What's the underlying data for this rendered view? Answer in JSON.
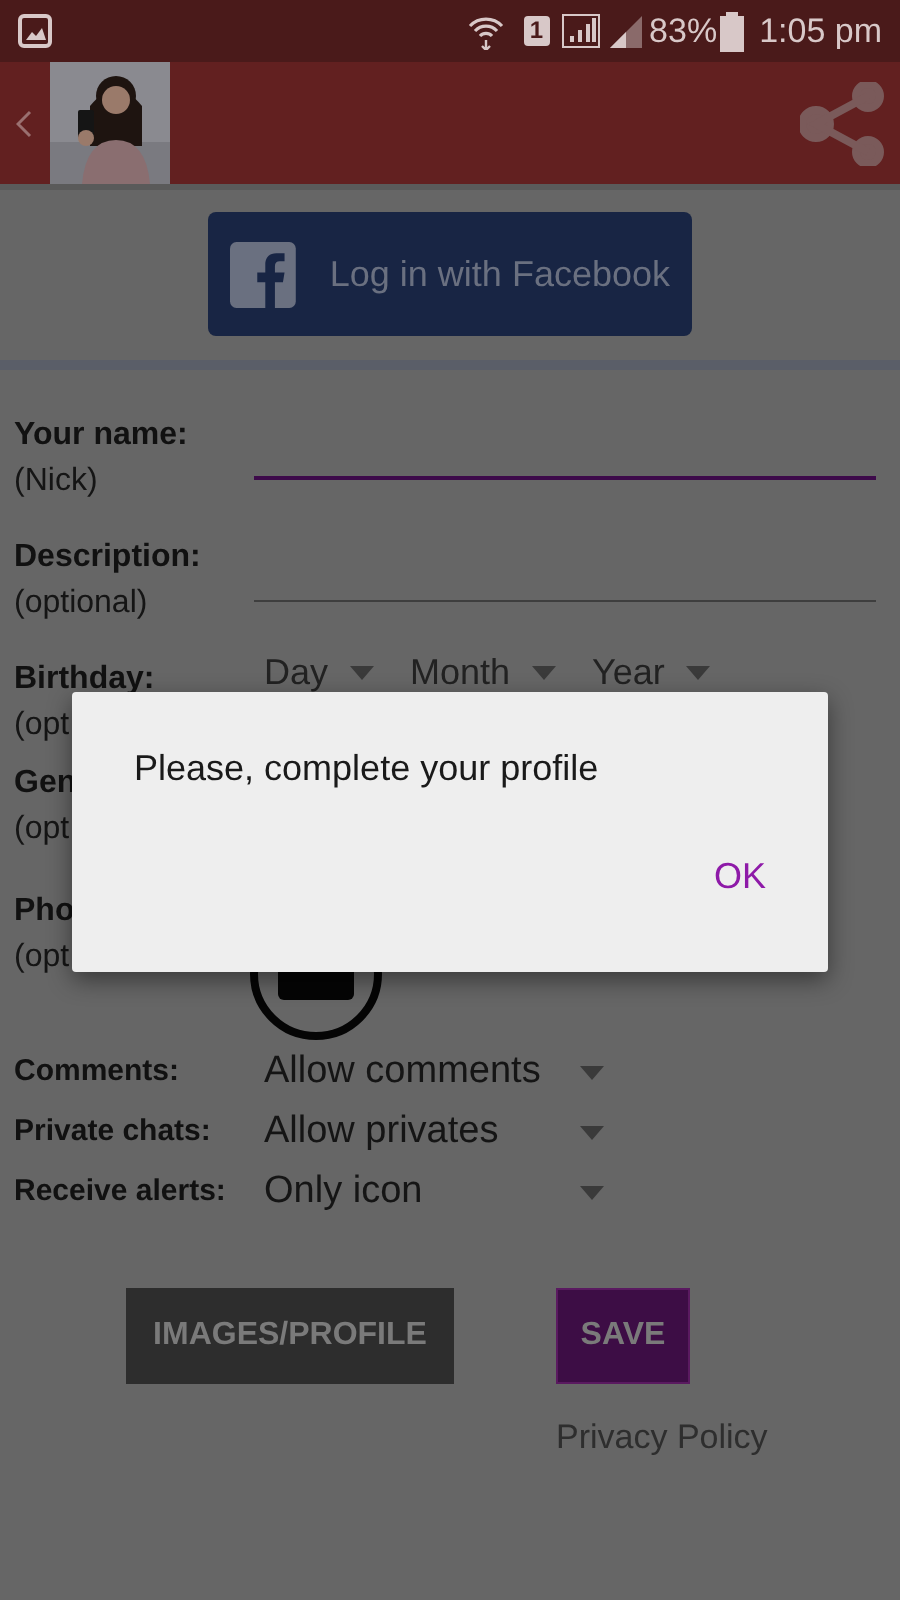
{
  "status_bar": {
    "sim": "1",
    "battery": "83%",
    "time": "1:05 pm"
  },
  "facebook_button": {
    "label": "Log in with Facebook"
  },
  "form": {
    "fields": [
      {
        "kind": "text",
        "label": "Your name:",
        "hint": "(Nick)",
        "focused": true
      },
      {
        "kind": "text",
        "label": "Description:",
        "hint": "(optional)",
        "focused": false
      },
      {
        "kind": "selects",
        "label": "Birthday:",
        "hint": "(opt",
        "options": [
          "Day",
          "Month",
          "Year"
        ]
      },
      {
        "kind": "plain",
        "label": "Gen",
        "hint": "(opt"
      },
      {
        "label": "Pho",
        "hint": "(opt"
      }
    ],
    "settings": [
      {
        "label": "Comments:",
        "value": "Allow comments"
      },
      {
        "label": "Private chats:",
        "value": "Allow privates"
      },
      {
        "label": "Receive alerts:",
        "value": "Only icon"
      }
    ]
  },
  "buttons": [
    {
      "kind": "secondary",
      "label": "IMAGES/PROFILE"
    },
    {
      "kind": "primary",
      "label": "SAVE"
    }
  ],
  "privacy_link": "Privacy Policy",
  "dialog": {
    "message": "Please, complete your profile",
    "button": "OK"
  }
}
